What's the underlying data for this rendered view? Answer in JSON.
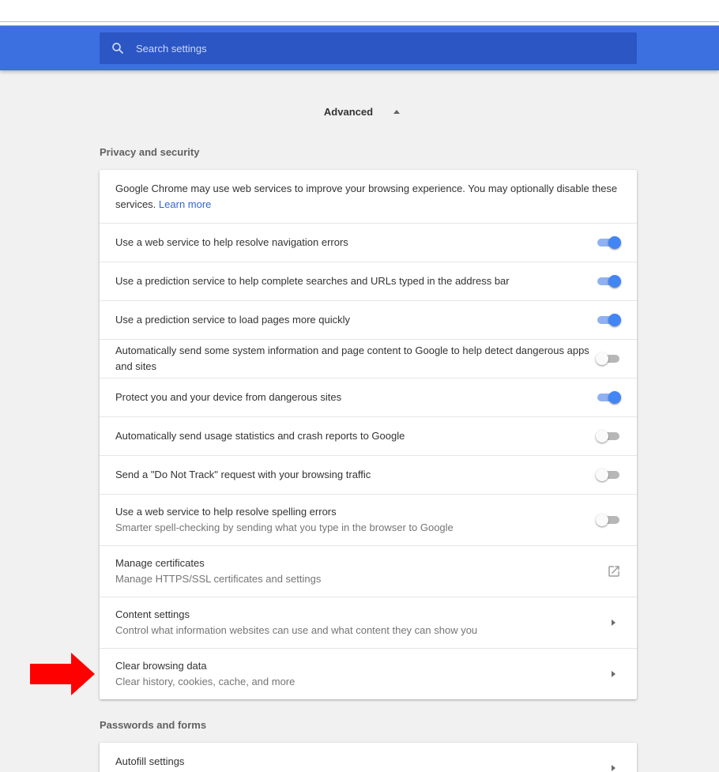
{
  "search": {
    "placeholder": "Search settings"
  },
  "advanced": {
    "label": "Advanced"
  },
  "privacy": {
    "title": "Privacy and security",
    "intro_text": "Google Chrome may use web services to improve your browsing experience. You may optionally disable these services.",
    "intro_link": "Learn more",
    "toggles": [
      {
        "label": "Use a web service to help resolve navigation errors",
        "on": true
      },
      {
        "label": "Use a prediction service to help complete searches and URLs typed in the address bar",
        "on": true
      },
      {
        "label": "Use a prediction service to load pages more quickly",
        "on": true
      },
      {
        "label": "Automatically send some system information and page content to Google to help detect dangerous apps and sites",
        "on": false
      },
      {
        "label": "Protect you and your device from dangerous sites",
        "on": true
      },
      {
        "label": "Automatically send usage statistics and crash reports to Google",
        "on": false
      },
      {
        "label": "Send a \"Do Not Track\" request with your browsing traffic",
        "on": false
      },
      {
        "label": "Use a web service to help resolve spelling errors",
        "sub": "Smarter spell-checking by sending what you type in the browser to Google",
        "on": false
      }
    ],
    "manage_certs": {
      "label": "Manage certificates",
      "sub": "Manage HTTPS/SSL certificates and settings"
    },
    "content_settings": {
      "label": "Content settings",
      "sub": "Control what information websites can use and what content they can show you"
    },
    "clear_browsing": {
      "label": "Clear browsing data",
      "sub": "Clear history, cookies, cache, and more"
    }
  },
  "passwords": {
    "title": "Passwords and forms",
    "autofill": {
      "label": "Autofill settings"
    }
  },
  "colors": {
    "header": "#3c6fe0",
    "toggle_on": "#4285f4",
    "arrow": "#ff0000",
    "link": "#3367d6"
  },
  "icons": {
    "search": "search-icon",
    "external": "open-in-new-icon",
    "chevron": "chevron-right-icon",
    "arrow": "red-arrow-icon"
  }
}
